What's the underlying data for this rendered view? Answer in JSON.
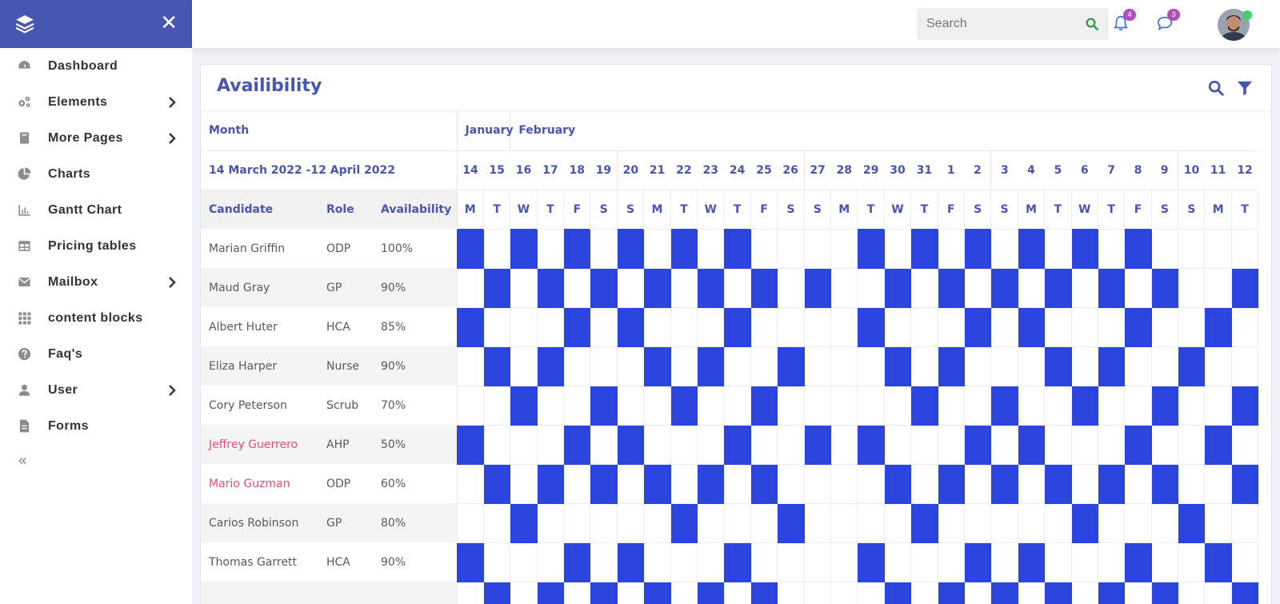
{
  "sidebar": {
    "items": [
      {
        "label": "Dashboard",
        "icon": "dashboard-icon",
        "chevron": false
      },
      {
        "label": "Elements",
        "icon": "cogs-icon",
        "chevron": true
      },
      {
        "label": "More Pages",
        "icon": "book-icon",
        "chevron": true
      },
      {
        "label": "Charts",
        "icon": "pie-chart-icon",
        "chevron": false
      },
      {
        "label": "Gantt Chart",
        "icon": "bar-chart-icon",
        "chevron": false
      },
      {
        "label": "Pricing tables",
        "icon": "table-icon",
        "chevron": false
      },
      {
        "label": "Mailbox",
        "icon": "envelope-icon",
        "chevron": true
      },
      {
        "label": "content blocks",
        "icon": "grid-icon",
        "chevron": false
      },
      {
        "label": "Faq's",
        "icon": "question-icon",
        "chevron": false
      },
      {
        "label": "User",
        "icon": "user-icon",
        "chevron": true
      },
      {
        "label": "Forms",
        "icon": "file-icon",
        "chevron": false
      }
    ],
    "collapse_glyph": "«"
  },
  "topbar": {
    "search_placeholder": "Search",
    "notifications_count": "4",
    "messages_count": "3"
  },
  "card": {
    "title": "Availibility",
    "month_label": "Month",
    "months": [
      "January",
      "February"
    ],
    "range_label": "14 March 2022 -12 April 2022",
    "col_candidate": "Candidate",
    "col_role": "Role",
    "col_availability": "Availability",
    "day_numbers": [
      "14",
      "15",
      "16",
      "17",
      "18",
      "19",
      "20",
      "21",
      "22",
      "23",
      "24",
      "25",
      "26",
      "27",
      "28",
      "29",
      "30",
      "31",
      "1",
      "2",
      "3",
      "4",
      "5",
      "6",
      "7",
      "8",
      "9",
      "10",
      "11",
      "12"
    ],
    "day_letters": [
      "M",
      "T",
      "W",
      "T",
      "F",
      "S",
      "S",
      "M",
      "T",
      "W",
      "T",
      "F",
      "S",
      "S",
      "M",
      "T",
      "W",
      "T",
      "F",
      "S",
      "S",
      "M",
      "T",
      "W",
      "T",
      "F",
      "S",
      "S",
      "M",
      "T"
    ],
    "rows": [
      {
        "name": "Marian Griffin",
        "role": "ODP",
        "availability": "100%",
        "highlight": false,
        "days": [
          1,
          0,
          1,
          0,
          1,
          0,
          1,
          0,
          1,
          0,
          1,
          0,
          0,
          0,
          0,
          1,
          0,
          1,
          0,
          1,
          0,
          1,
          0,
          1,
          0,
          1,
          0,
          0,
          0,
          0
        ]
      },
      {
        "name": "Maud Gray",
        "role": "GP",
        "availability": "90%",
        "highlight": false,
        "days": [
          0,
          1,
          0,
          1,
          0,
          1,
          0,
          1,
          0,
          1,
          0,
          1,
          0,
          1,
          0,
          0,
          1,
          0,
          1,
          0,
          1,
          0,
          1,
          0,
          1,
          0,
          1,
          0,
          0,
          1
        ]
      },
      {
        "name": "Albert Huter",
        "role": "HCA",
        "availability": "85%",
        "highlight": false,
        "days": [
          1,
          0,
          0,
          0,
          1,
          0,
          1,
          0,
          0,
          0,
          1,
          0,
          0,
          0,
          0,
          1,
          0,
          0,
          0,
          1,
          0,
          1,
          0,
          0,
          0,
          1,
          0,
          0,
          1,
          0
        ]
      },
      {
        "name": "Eliza Harper",
        "role": "Nurse",
        "availability": "90%",
        "highlight": false,
        "days": [
          0,
          1,
          0,
          1,
          0,
          0,
          0,
          1,
          0,
          1,
          0,
          0,
          1,
          0,
          0,
          0,
          1,
          0,
          1,
          0,
          0,
          0,
          1,
          0,
          1,
          0,
          0,
          1,
          0,
          0
        ]
      },
      {
        "name": "Cory Peterson",
        "role": "Scrub",
        "availability": "70%",
        "highlight": false,
        "days": [
          0,
          0,
          1,
          0,
          0,
          1,
          0,
          0,
          1,
          0,
          0,
          1,
          0,
          0,
          0,
          0,
          0,
          1,
          0,
          0,
          1,
          0,
          0,
          1,
          0,
          0,
          1,
          0,
          0,
          1
        ]
      },
      {
        "name": "Jeffrey Guerrero",
        "role": "AHP",
        "availability": "50%",
        "highlight": true,
        "days": [
          1,
          0,
          0,
          0,
          1,
          0,
          1,
          0,
          0,
          0,
          1,
          0,
          0,
          1,
          0,
          1,
          0,
          0,
          0,
          1,
          0,
          1,
          0,
          0,
          0,
          1,
          0,
          0,
          1,
          0
        ]
      },
      {
        "name": "Mario Guzman",
        "role": "ODP",
        "availability": "60%",
        "highlight": true,
        "days": [
          0,
          1,
          0,
          1,
          0,
          1,
          0,
          1,
          0,
          1,
          0,
          1,
          0,
          0,
          0,
          0,
          1,
          0,
          1,
          0,
          1,
          0,
          1,
          0,
          1,
          0,
          1,
          0,
          0,
          1
        ]
      },
      {
        "name": "Carios Robinson",
        "role": "GP",
        "availability": "80%",
        "highlight": false,
        "days": [
          0,
          0,
          1,
          0,
          0,
          0,
          0,
          0,
          1,
          0,
          0,
          0,
          1,
          0,
          0,
          0,
          0,
          1,
          0,
          0,
          0,
          0,
          0,
          1,
          0,
          0,
          0,
          1,
          0,
          0
        ]
      },
      {
        "name": "Thomas Garrett",
        "role": "HCA",
        "availability": "90%",
        "highlight": false,
        "days": [
          1,
          0,
          0,
          0,
          1,
          0,
          1,
          0,
          0,
          0,
          1,
          0,
          0,
          0,
          0,
          1,
          0,
          0,
          0,
          1,
          0,
          1,
          0,
          0,
          0,
          1,
          0,
          0,
          1,
          0
        ]
      },
      {
        "name": "",
        "role": "",
        "availability": "",
        "highlight": false,
        "days": [
          0,
          1,
          0,
          1,
          0,
          1,
          0,
          1,
          0,
          1,
          0,
          1,
          0,
          0,
          0,
          0,
          1,
          0,
          1,
          0,
          1,
          0,
          1,
          0,
          1,
          0,
          1,
          0,
          0,
          1
        ]
      }
    ]
  },
  "colors": {
    "brand": "#4756b2",
    "cell_on": "#2a44dd",
    "highlight_name": "#e94e77",
    "badge": "#b34fbd"
  }
}
